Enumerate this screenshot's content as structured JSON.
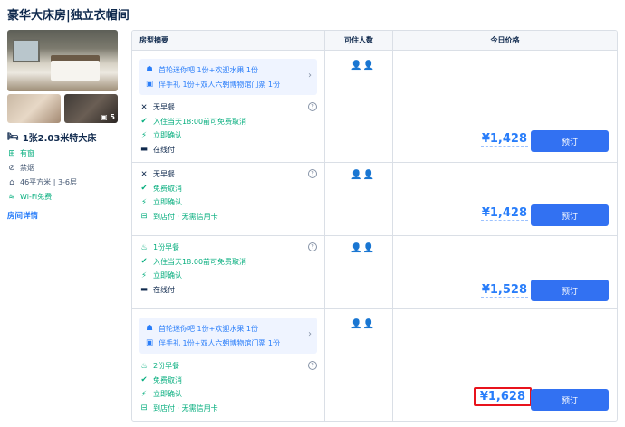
{
  "room": {
    "title": "豪华大床房|独立衣帽间",
    "photo_count": "5",
    "bed": "1张2.03米特大床",
    "facilities": [
      {
        "icon": "window-icon",
        "text": "有窗",
        "green": true
      },
      {
        "icon": "no-smoking-icon",
        "text": "禁烟",
        "green": false
      },
      {
        "icon": "area-icon",
        "text": "46平方米 | 3-6层",
        "green": false
      },
      {
        "icon": "wifi-icon",
        "text": "Wi-Fi免费",
        "green": true
      }
    ],
    "details_link": "房间详情"
  },
  "table": {
    "headers": [
      "房型摘要",
      "可住人数",
      "今日价格"
    ],
    "book_label": "预订",
    "rows": [
      {
        "package": [
          "首轮迷你吧 1份+欢迎水果 1份",
          "伴手礼 1份+双人六朝博物馆门票 1份"
        ],
        "meal": "无早餐",
        "cancel": "入住当天18:00前可免费取消",
        "confirm": "立即确认",
        "payment": "在线付",
        "guests": "2",
        "price": "¥1,428"
      },
      {
        "meal": "无早餐",
        "cancel": "免费取消",
        "confirm": "立即确认",
        "payment": "到店付 · 无需信用卡",
        "guests": "2",
        "price": "¥1,428"
      },
      {
        "meal": "1份早餐",
        "cancel": "入住当天18:00前可免费取消",
        "confirm": "立即确认",
        "payment": "在线付",
        "guests": "2",
        "price": "¥1,528"
      },
      {
        "package": [
          "首轮迷你吧 1份+欢迎水果 1份",
          "伴手礼 1份+双人六朝博物馆门票 1份"
        ],
        "meal": "2份早餐",
        "cancel": "免费取消",
        "confirm": "立即确认",
        "payment": "到店付 · 无需信用卡",
        "guests": "2",
        "price": "¥1,628",
        "highlighted": true
      }
    ]
  },
  "colors": {
    "accent": "#287dfa",
    "button": "#3271f2",
    "green": "#06ae7e",
    "highlight": "#e8131c"
  }
}
